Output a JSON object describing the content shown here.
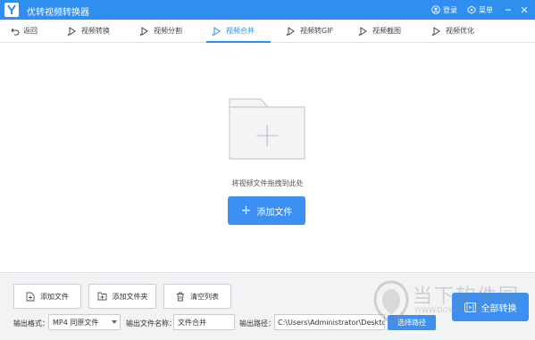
{
  "app": {
    "title": "优转视频转换器",
    "login_label": "登录",
    "menu_label": "菜单"
  },
  "nav": {
    "back_label": "返回",
    "items": [
      {
        "label": "视频转换"
      },
      {
        "label": "视频分割"
      },
      {
        "label": "视频合并"
      },
      {
        "label": "视频转GIF"
      },
      {
        "label": "视频截图"
      },
      {
        "label": "视频优化"
      }
    ],
    "active": "视频合并"
  },
  "main": {
    "drop_hint": "将视频文件拖拽到此处",
    "add_file_label": "添加文件"
  },
  "bottom": {
    "add_file_label": "添加文件",
    "add_folder_label": "添加文件夹",
    "clear_list_label": "清空列表",
    "output_format_label": "输出格式：",
    "output_format_value": "MP4  同原文件",
    "output_name_label": "输出文件名称：",
    "output_name_value": "文件合并",
    "output_path_label": "输出路径：",
    "output_path_value": "C:\\Users\\Administrator\\Desktop",
    "choose_path_label": "选择路径",
    "convert_all_label": "全部转换"
  },
  "watermark": {
    "text": "当下软件园",
    "sub": "WWW.DOWNXIA.COM"
  },
  "colors": {
    "accent": "#2f8ef0",
    "button": "#3b90f2",
    "bottom_bg": "#f2f3f5"
  }
}
